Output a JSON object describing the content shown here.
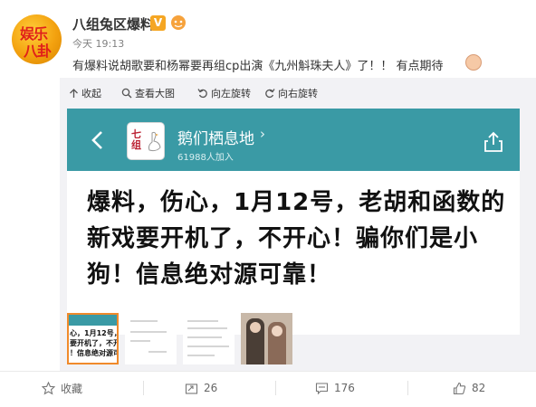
{
  "account": {
    "name": "八组兔区爆料",
    "time": "今天 19:13",
    "avatar_text_1": "娱乐",
    "avatar_text_2": "八卦"
  },
  "post": {
    "text": "有爆料说胡歌要和杨幂要再组cp出演《九州斛珠夫人》了！！ 有点期待"
  },
  "toolbar": {
    "collapse": "收起",
    "view_large": "查看大图",
    "rotate_left": "向左旋转",
    "rotate_right": "向右旋转"
  },
  "screenshot": {
    "group_logo_text": "七组",
    "group_name": "鹅们栖息地",
    "group_count": "61988人加入",
    "message": "爆料，伤心，1月12号，老胡和函数的新戏要开机了，不开心！骗你们是小狗！信息绝对源可靠！",
    "header_color": "#3a9aa5"
  },
  "thumbs": {
    "first_text_1": "心，1月12号，老",
    "first_text_2": "要开机了，不开",
    "first_text_3": "！信息绝对源可"
  },
  "actions": {
    "favorite": "收藏",
    "repost_count": "26",
    "comment_count": "176",
    "like_count": "82"
  }
}
